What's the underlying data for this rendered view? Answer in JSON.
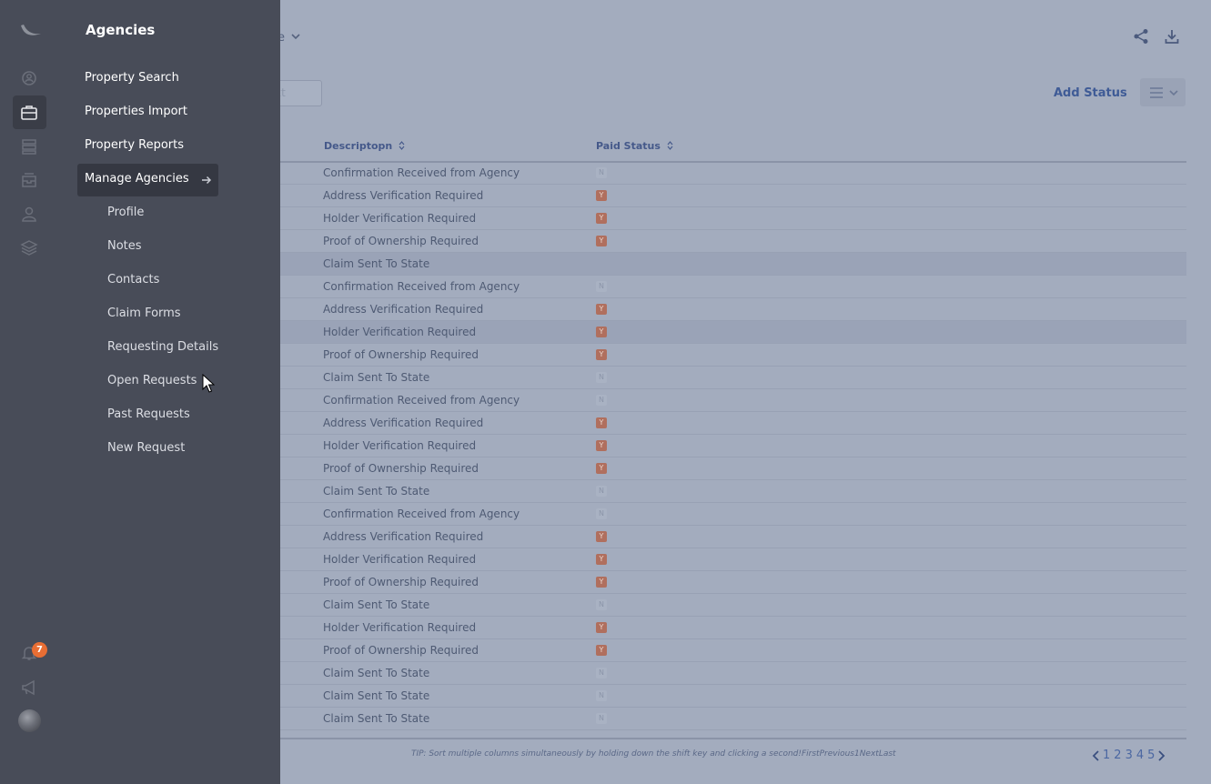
{
  "panel": {
    "title": "Agencies",
    "nav": [
      "Property Search",
      "Properties Import",
      "Property Reports"
    ],
    "active_nav": "Manage Agencies",
    "subnav": [
      "Profile",
      "Notes",
      "Contacts",
      "Claim Forms",
      "Requesting Details",
      "Open Requests",
      "Past Requests",
      "New Request"
    ]
  },
  "rail": {
    "icons": [
      "logo-icon",
      "agencies-icon",
      "briefcase-icon",
      "servers-icon",
      "inbox-icon",
      "user-icon",
      "layers-icon",
      "bell-icon",
      "megaphone-icon"
    ],
    "notification_count": "7"
  },
  "main": {
    "toolbar_fragment": "e",
    "search_placeholder_fragment": "xt",
    "add_status_label": "Add Status",
    "columns": {
      "description": "Descriptopn",
      "paid_status": "Paid Status"
    },
    "rows": [
      {
        "desc": "Confirmation Received from Agency",
        "paid": "N"
      },
      {
        "desc": "Address Verification Required",
        "paid": "Y"
      },
      {
        "desc": "Holder Verification Required",
        "paid": "Y"
      },
      {
        "desc": "Proof of Ownership Required",
        "paid": "Y"
      },
      {
        "desc": "Claim Sent To State",
        "paid": ""
      },
      {
        "desc": "Confirmation Received from Agency",
        "paid": "N"
      },
      {
        "desc": "Address Verification Required",
        "paid": "Y"
      },
      {
        "desc": "Holder Verification Required",
        "paid": "Y"
      },
      {
        "desc": "Proof of Ownership Required",
        "paid": "Y"
      },
      {
        "desc": "Claim Sent To State",
        "paid": "N"
      },
      {
        "desc": "Confirmation Received from Agency",
        "paid": "N"
      },
      {
        "desc": "Address Verification Required",
        "paid": "Y"
      },
      {
        "desc": "Holder Verification Required",
        "paid": "Y"
      },
      {
        "desc": "Proof of Ownership Required",
        "paid": "Y"
      },
      {
        "desc": "Claim Sent To State",
        "paid": "N"
      },
      {
        "desc": "Confirmation Received from Agency",
        "paid": "N"
      },
      {
        "desc": "Address Verification Required",
        "paid": "Y"
      },
      {
        "desc": "Holder Verification Required",
        "paid": "Y"
      },
      {
        "desc": "Proof of Ownership Required",
        "paid": "Y"
      },
      {
        "desc": "Claim Sent To State",
        "paid": "N"
      },
      {
        "desc": "Holder Verification Required",
        "paid": "Y"
      },
      {
        "desc": "Proof of Ownership Required",
        "paid": "Y"
      },
      {
        "desc": "Claim Sent To State",
        "paid": "N"
      },
      {
        "desc": "Claim Sent To State",
        "paid": "N"
      },
      {
        "desc": "Claim Sent To State",
        "paid": "N"
      }
    ],
    "highlighted_rows": [
      4,
      7
    ],
    "tip": "TIP: Sort multiple columns simultaneously by holding down the shift key and clicking a second!FirstPrevious1NextLast",
    "pages": [
      "1",
      "2",
      "3",
      "4",
      "5"
    ]
  }
}
